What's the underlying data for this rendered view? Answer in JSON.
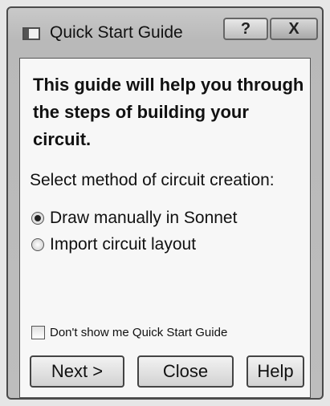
{
  "window": {
    "title": "Quick Start Guide",
    "help_glyph": "?",
    "close_glyph": "X"
  },
  "content": {
    "intro": "This guide will help you through the steps of building your circuit.",
    "prompt": "Select method of circuit creation:",
    "options": [
      {
        "label": "Draw manually in Sonnet",
        "selected": true
      },
      {
        "label": "Import circuit layout",
        "selected": false
      }
    ],
    "dont_show_label": "Don't show me Quick Start Guide",
    "dont_show_checked": false
  },
  "buttons": {
    "next": "Next >",
    "close": "Close",
    "help": "Help"
  },
  "icons": {
    "app": "window-app-icon",
    "help": "question-icon",
    "close": "close-icon"
  }
}
